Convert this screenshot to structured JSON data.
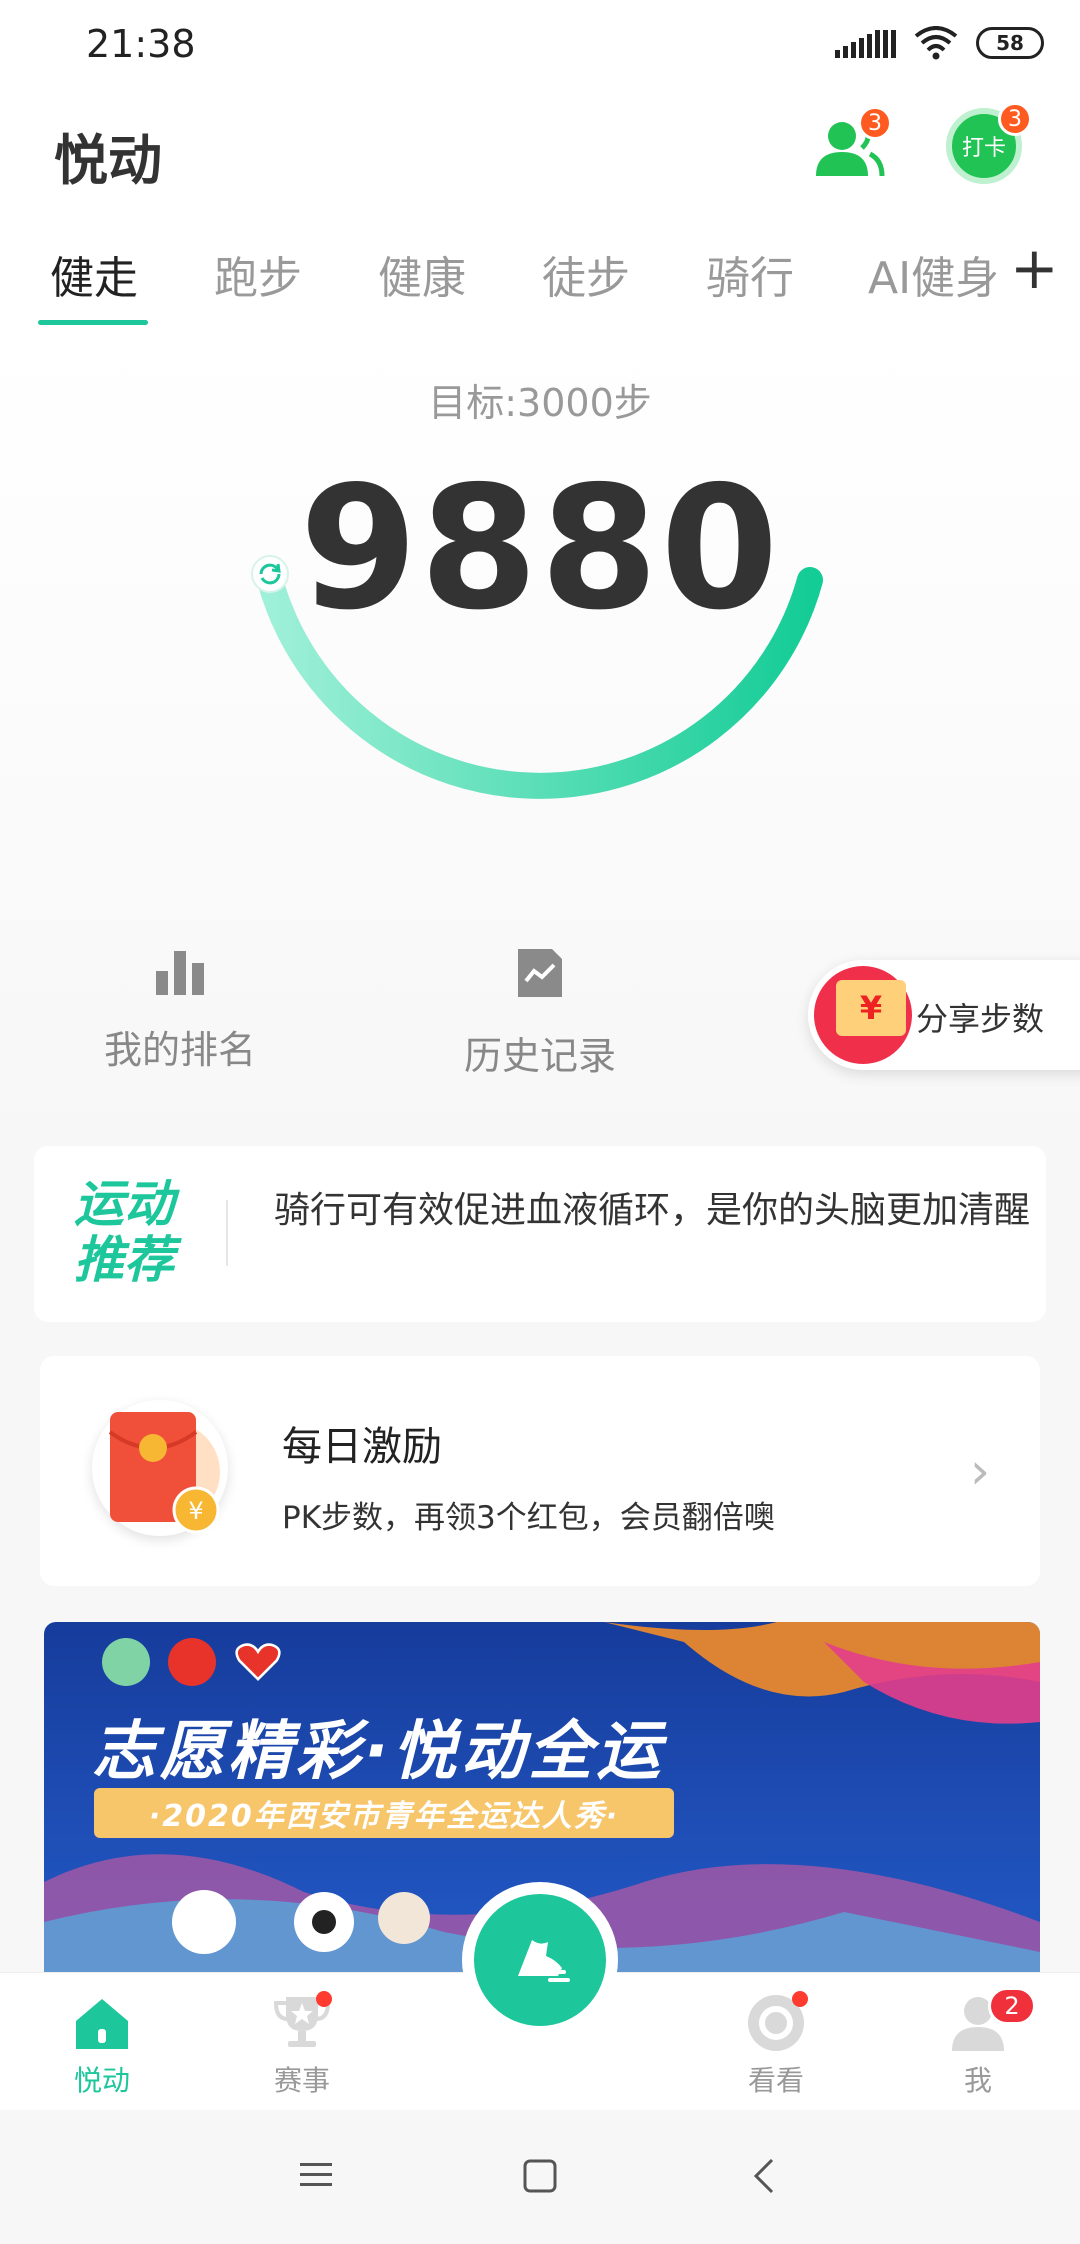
{
  "status_bar": {
    "time": "21:38",
    "battery": "58"
  },
  "header": {
    "title": "悦动",
    "friends_badge": "3",
    "checkin_label": "打卡",
    "checkin_badge": "3"
  },
  "tabs": [
    {
      "label": "健走"
    },
    {
      "label": "跑步"
    },
    {
      "label": "健康"
    },
    {
      "label": "徒步"
    },
    {
      "label": "骑行"
    },
    {
      "label": "AI健身"
    }
  ],
  "tab_add": "+",
  "steps": {
    "goal": "目标:3000步",
    "count": "9880",
    "progress": 1.0
  },
  "actions": {
    "ranking": "我的排名",
    "history": "历史记录",
    "share": "分享步数",
    "share_symbol": "¥"
  },
  "recommend": {
    "title": "运动推荐",
    "text": "骑行可有效促进血液循环，是你的头脑更加清醒"
  },
  "daily": {
    "title": "每日激励",
    "subtitle": "PK步数，再领3个红包，会员翻倍噢",
    "coin_symbol": "¥"
  },
  "banner": {
    "title": "志愿精彩·悦动全运",
    "subtitle": "·2020年西安市青年全运达人秀·"
  },
  "bottom_nav": {
    "home": "悦动",
    "events": "赛事",
    "watch": "看看",
    "me": "我",
    "me_badge": "2"
  },
  "colors": {
    "accent": "#1dc79b",
    "badge": "#ff5a1f",
    "checkin": "#22c355"
  }
}
